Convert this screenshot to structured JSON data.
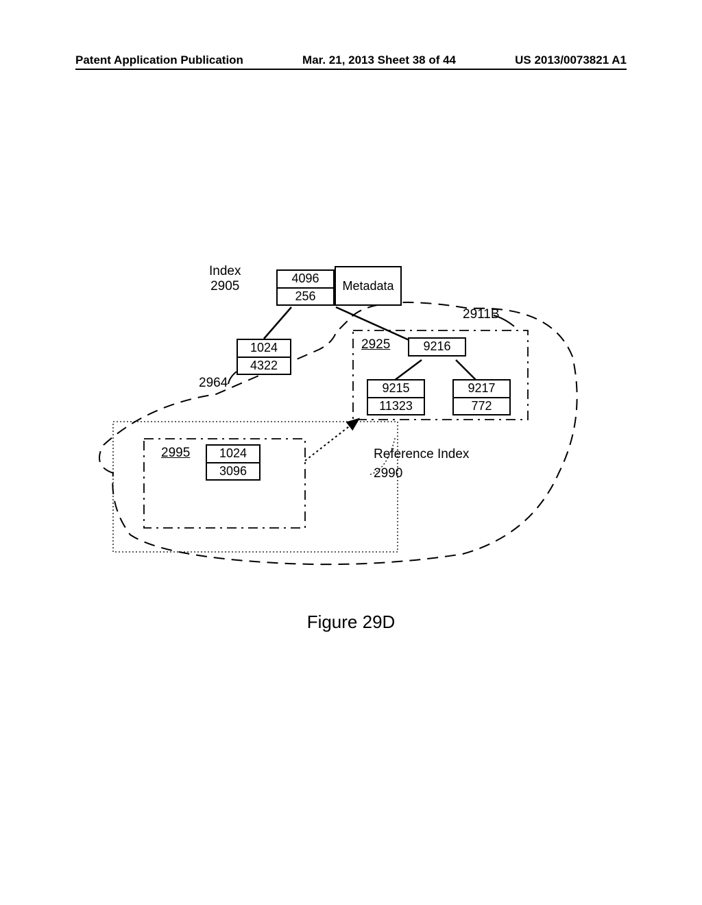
{
  "header": {
    "left": "Patent Application Publication",
    "center": "Mar. 21, 2013  Sheet 38 of 44",
    "right": "US 2013/0073821 A1"
  },
  "diagram": {
    "index_label": "Index",
    "index_ref": "2905",
    "root_box": {
      "top": "4096",
      "bottom": "256"
    },
    "metadata": "Metadata",
    "left_box": {
      "top": "1024",
      "bottom": "4322"
    },
    "ref_2964": "2964",
    "ref_2911B": "2911B",
    "ref_2925": "2925",
    "box_9216": {
      "val": "9216"
    },
    "box_9215": {
      "top": "9215",
      "bottom": "11323"
    },
    "box_9217": {
      "top": "9217",
      "bottom": "772"
    },
    "ref_2995": "2995",
    "box_2995": {
      "top": "1024",
      "bottom": "3096"
    },
    "ref_index_label": "Reference Index",
    "ref_2990": "2990"
  },
  "caption": "Figure 29D"
}
